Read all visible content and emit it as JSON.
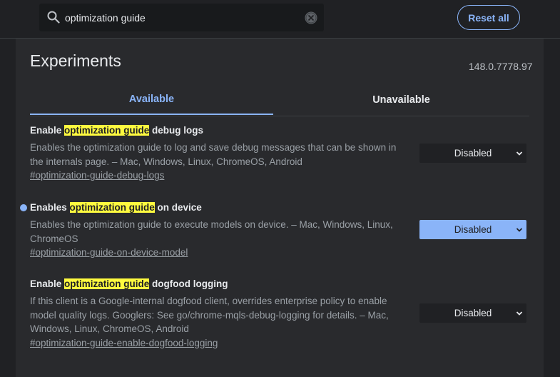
{
  "search": {
    "value": "optimization guide",
    "icon": "search-icon",
    "clear_icon": "close-icon"
  },
  "header": {
    "reset_label": "Reset all"
  },
  "page": {
    "title": "Experiments",
    "version": "148.0.7778.97"
  },
  "tabs": [
    {
      "label": "Available",
      "selected": true
    },
    {
      "label": "Unavailable",
      "selected": false
    }
  ],
  "experiments": [
    {
      "name_before": "Enable ",
      "name_highlight": "optimization guide",
      "name_after": " debug logs",
      "description": "Enables the optimization guide to log and save debug messages that can be shown in the internals page. – Mac, Windows, Linux, ChromeOS, Android",
      "link": "#optimization-guide-debug-logs",
      "value": "Disabled"
    },
    {
      "name_before": "Enables ",
      "name_highlight": "optimization guide",
      "name_after": " on device",
      "description": "Enables the optimization guide to execute models on device. – Mac, Windows, Linux, ChromeOS",
      "link": "#optimization-guide-on-device-model",
      "value": "Disabled",
      "modified": true
    },
    {
      "name_before": "Enable ",
      "name_highlight": "optimization guide",
      "name_after": " dogfood logging",
      "description": "If this client is a Google-internal dogfood client, overrides enterprise policy to enable model quality logs. Googlers: See go/chrome-mqls-debug-logging for details. – Mac, Windows, Linux, ChromeOS, Android",
      "link": "#optimization-guide-enable-dogfood-logging",
      "value": "Disabled"
    }
  ],
  "colors": {
    "accent": "#8ab4f8",
    "highlight": "#fefa3f",
    "background": "#202124",
    "panel": "#292a2d"
  }
}
